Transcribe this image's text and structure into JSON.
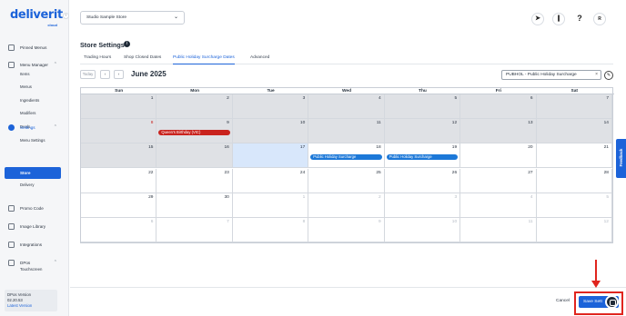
{
  "brand": {
    "name": "deliverit",
    "sub": "cloud"
  },
  "sidebar": {
    "collapse_icon": "chevron-left-icon",
    "items": [
      {
        "label": "Pinned Menus",
        "icon": "pin-icon"
      },
      {
        "label": "Menu Manager",
        "icon": "menu-icon",
        "expanded": true,
        "children": [
          "Items",
          "Menus",
          "Ingredients",
          "Modifiers",
          "Deals",
          "Menu Settings"
        ]
      },
      {
        "label": "Settings",
        "icon": "gear-icon",
        "expanded": true,
        "children": [
          "Store",
          "Delivery"
        ],
        "active_child": "Store"
      },
      {
        "label": "Promo Code",
        "icon": "tag-icon"
      },
      {
        "label": "Image Library",
        "icon": "image-icon"
      },
      {
        "label": "Integrations",
        "icon": "plug-icon"
      },
      {
        "label": "DPos",
        "icon": "pos-icon",
        "expanded": true,
        "children": [
          "Touchscreen"
        ]
      }
    ],
    "version": {
      "label": "DPos Version",
      "value": "02.20.53",
      "latest": "Latest Version"
    }
  },
  "topbar": {
    "store_select": "Studio Sample Store",
    "icons": [
      {
        "name": "rocket-icon",
        "glyph": "🚀"
      },
      {
        "name": "attachment-icon",
        "glyph": "📎"
      },
      {
        "name": "help-icon",
        "glyph": "?"
      },
      {
        "name": "avatar",
        "glyph": "R"
      }
    ]
  },
  "page": {
    "title": "Store Settings",
    "tabs": [
      "Trading Hours",
      "Shop Closed Dates",
      "Public Holiday Surcharge Dates",
      "Advanced"
    ],
    "active_tab": "Public Holiday Surcharge Dates"
  },
  "calendar": {
    "today_label": "Today",
    "prev": "‹",
    "next": "›",
    "month_title": "June 2025",
    "filter_value": "PUBHOL - Public Holiday Surcharge",
    "clear_icon": "×",
    "edit_icon": "✎",
    "days_of_week": [
      "Sun",
      "Mon",
      "Tue",
      "Wed",
      "Thu",
      "Fri",
      "Sat"
    ],
    "weeks": [
      [
        {
          "d": "1",
          "past": true
        },
        {
          "d": "2",
          "past": true
        },
        {
          "d": "3",
          "past": true
        },
        {
          "d": "4",
          "past": true
        },
        {
          "d": "5",
          "past": true
        },
        {
          "d": "6",
          "past": true
        },
        {
          "d": "7",
          "past": true
        }
      ],
      [
        {
          "d": "8",
          "past": true,
          "red": true
        },
        {
          "d": "9",
          "past": true,
          "event": "Queen's Birthday (VIC)",
          "color": "red"
        },
        {
          "d": "10",
          "past": true
        },
        {
          "d": "11",
          "past": true
        },
        {
          "d": "12",
          "past": true
        },
        {
          "d": "13",
          "past": true
        },
        {
          "d": "14",
          "past": true
        }
      ],
      [
        {
          "d": "15",
          "past": true
        },
        {
          "d": "16",
          "past": true
        },
        {
          "d": "17",
          "today": true
        },
        {
          "d": "18",
          "event": "Public Holiday Surcharge",
          "color": "blue"
        },
        {
          "d": "19",
          "event": "Public Holiday Surcharge",
          "color": "blue"
        },
        {
          "d": "20"
        },
        {
          "d": "21"
        }
      ],
      [
        {
          "d": "22"
        },
        {
          "d": "23"
        },
        {
          "d": "24"
        },
        {
          "d": "25"
        },
        {
          "d": "26"
        },
        {
          "d": "27"
        },
        {
          "d": "28"
        }
      ],
      [
        {
          "d": "29"
        },
        {
          "d": "30"
        },
        {
          "d": "1",
          "other": true
        },
        {
          "d": "2",
          "other": true
        },
        {
          "d": "3",
          "other": true
        },
        {
          "d": "4",
          "other": true
        },
        {
          "d": "5",
          "other": true
        }
      ],
      [
        {
          "d": "6",
          "other": true
        },
        {
          "d": "7",
          "other": true
        },
        {
          "d": "8",
          "other": true
        },
        {
          "d": "9",
          "other": true
        },
        {
          "d": "10",
          "other": true
        },
        {
          "d": "11",
          "other": true
        },
        {
          "d": "12",
          "other": true
        }
      ]
    ]
  },
  "feedback_label": "Feedback",
  "footer": {
    "cancel": "Cancel",
    "save": "Save Sett"
  },
  "colors": {
    "accent": "#1c63d9",
    "holiday": "#c9231e",
    "surcharge": "#1c78d8",
    "highlight": "#e0251e"
  }
}
